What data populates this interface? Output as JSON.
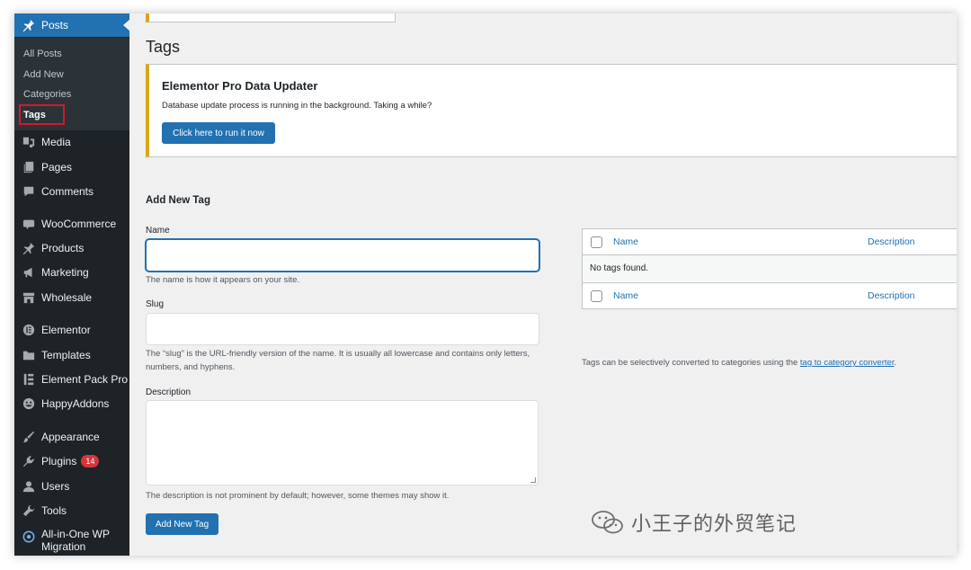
{
  "sidebar": {
    "posts_label": "Posts",
    "submenu": [
      "All Posts",
      "Add New",
      "Categories",
      "Tags"
    ],
    "items": {
      "media": "Media",
      "pages": "Pages",
      "comments": "Comments",
      "woocommerce": "WooCommerce",
      "products": "Products",
      "marketing": "Marketing",
      "wholesale": "Wholesale",
      "elementor": "Elementor",
      "templates": "Templates",
      "element_pack": "Element Pack Pro",
      "happyaddons": "HappyAddons",
      "appearance": "Appearance",
      "plugins": "Plugins",
      "plugins_badge": "14",
      "users": "Users",
      "tools": "Tools",
      "migration_line1": "All-in-One WP",
      "migration_line2": "Migration"
    },
    "icons": [
      "pushpin-icon",
      "media-icon",
      "pages-icon",
      "comments-icon",
      "woocommerce-icon",
      "products-icon",
      "marketing-icon",
      "wholesale-icon",
      "elementor-icon",
      "templates-icon",
      "element-pack-icon",
      "happyaddons-icon",
      "appearance-icon",
      "plugins-icon",
      "users-icon",
      "tools-icon",
      "migration-icon"
    ],
    "colors": {
      "background": "#1d2327",
      "active": "#2271b1",
      "badge": "#d63638",
      "highlight_box": "#d11a2a"
    }
  },
  "page": {
    "title": "Tags"
  },
  "notice": {
    "title": "Elementor Pro Data Updater",
    "text": "Database update process is running in the background. Taking a while?",
    "button": "Click here to run it now",
    "accent_color": "#dba617"
  },
  "form": {
    "heading": "Add New Tag",
    "name_label": "Name",
    "name_value": "",
    "name_help": "The name is how it appears on your site.",
    "slug_label": "Slug",
    "slug_value": "",
    "slug_help": "The “slug” is the URL-friendly version of the name. It is usually all lowercase and contains only letters, numbers, and hyphens.",
    "description_label": "Description",
    "description_value": "",
    "description_help": "The description is not prominent by default; however, some themes may show it.",
    "submit_button": "Add New Tag"
  },
  "table": {
    "columns": [
      "Name",
      "Description"
    ],
    "empty_message": "No tags found.",
    "footer_columns": [
      "Name",
      "Description"
    ]
  },
  "converter": {
    "text": "Tags can be selectively converted to categories using the ",
    "link": "tag to category converter",
    "suffix": "."
  },
  "watermark": {
    "text": "小王子的外贸笔记"
  }
}
